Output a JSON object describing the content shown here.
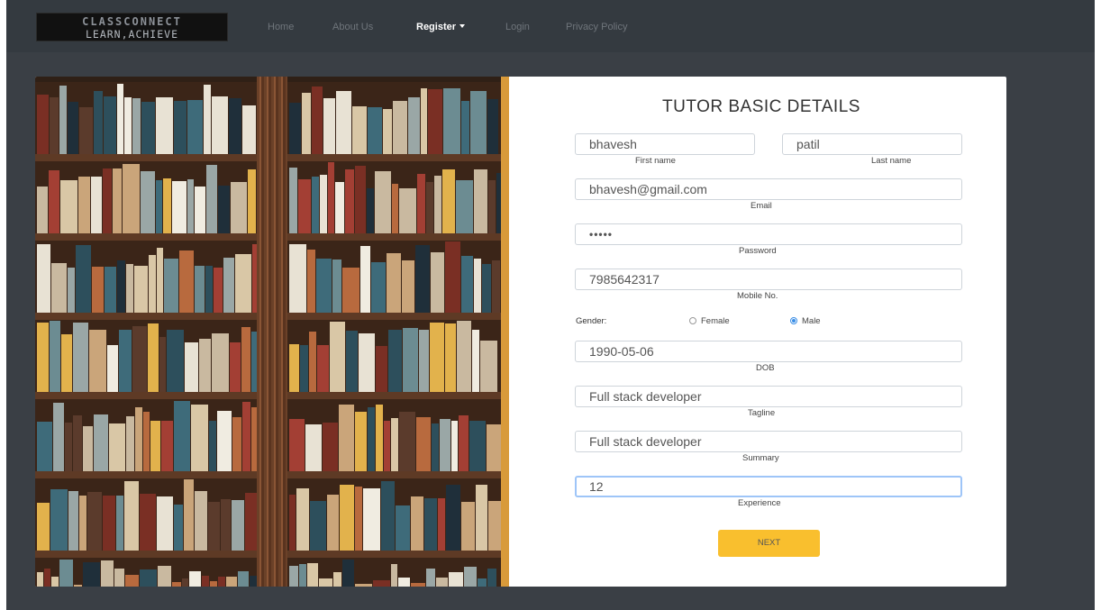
{
  "navbar": {
    "brand_line1": "CLASSCONNECT",
    "brand_line2": "LEARN,ACHIEVE",
    "links": [
      "Home",
      "About Us",
      "Register",
      "Login",
      "Privacy Policy"
    ]
  },
  "form": {
    "title": "TUTOR BASIC DETAILS",
    "first_name": {
      "value": "bhavesh",
      "label": "First name"
    },
    "last_name": {
      "value": "patil",
      "label": "Last name"
    },
    "email": {
      "value": "bhavesh@gmail.com",
      "label": "Email"
    },
    "password": {
      "value": "•••••",
      "label": "Password"
    },
    "mobile": {
      "value": "7985642317",
      "label": "Mobile No."
    },
    "gender": {
      "label": "Gender:",
      "options": [
        "Female",
        "Male"
      ],
      "selected": "Male"
    },
    "dob": {
      "value": "1990-05-06",
      "label": "DOB"
    },
    "tagline": {
      "value": "Full stack developer",
      "label": "Tagline"
    },
    "summary": {
      "value": "Full stack developer",
      "label": "Summary"
    },
    "experience": {
      "value": "12",
      "label": "Experience"
    },
    "next_label": "NEXT"
  },
  "colors": {
    "navbar": "#343a40",
    "background": "#3a3f45",
    "button": "#f9bf2e",
    "focus_border": "#9ec5f8"
  }
}
